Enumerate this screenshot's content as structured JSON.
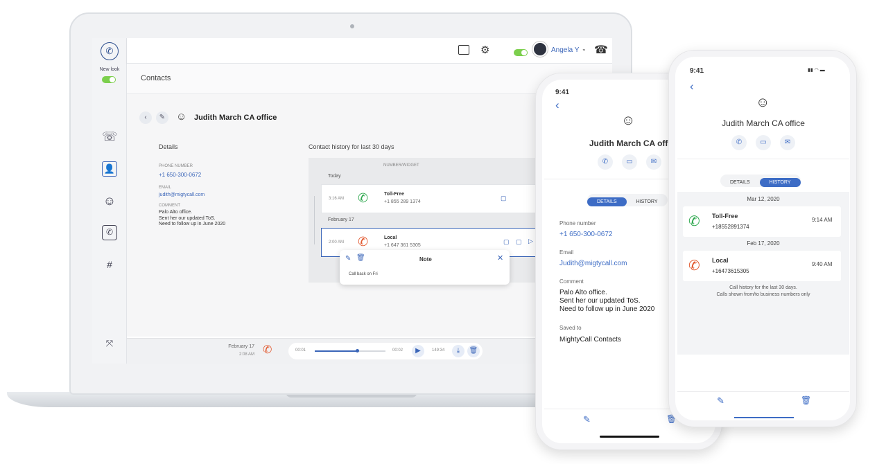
{
  "laptop": {
    "rail": {
      "new_look_label": "New look"
    },
    "topbar": {
      "user_name": "Angela Y"
    },
    "page_title": "Contacts",
    "contact": {
      "name": "Judith March CA office",
      "details_heading": "Details",
      "phone_label": "PHONE NUMBER",
      "phone_value": "+1 650-300-0672",
      "email_label": "EMAIL",
      "email_value": "judith@migtycall.com",
      "comment_label": "COMMENT",
      "comment_lines": [
        "Palo Alto office.",
        "Sent her our updated ToS.",
        "Need to follow up in June 2020"
      ]
    },
    "history": {
      "heading": "Contact history for last 30 days",
      "column_header": "NUMBER/WIDGET",
      "groups": [
        {
          "date": "Today",
          "items": [
            {
              "time": "3:16 AM",
              "type": "Toll-Free",
              "number": "+1 855 289 1374"
            }
          ]
        },
        {
          "date": "February 17",
          "items": [
            {
              "time": "2:00 AM",
              "type": "Local",
              "number": "+1 647 361 5305"
            }
          ]
        }
      ]
    },
    "note": {
      "title": "Note",
      "text": "Call back on Fri"
    },
    "player": {
      "date": "February 17",
      "time": "2:08 AM",
      "elapsed": "00:01",
      "end": "00:02",
      "duration": "149:34",
      "progress": 0.6
    }
  },
  "phone1": {
    "status_time": "9:41",
    "contact_name": "Judith March CA office",
    "tabs": [
      "DETAILS",
      "HISTORY"
    ],
    "active_tab": "DETAILS",
    "phone_label": "Phone number",
    "phone_value": "+1 650-300-0672",
    "email_label": "Email",
    "email_value": "Judith@migtycall.com",
    "comment_label": "Comment",
    "comment_lines": [
      "Palo Alto office.",
      "Sent her our updated ToS.",
      "Need to follow up in June 2020"
    ],
    "saved_label": "Saved to",
    "saved_value": "MightyCall Contacts"
  },
  "phone2": {
    "status_time": "9:41",
    "contact_name": "Judith March CA office",
    "tabs": [
      "DETAILS",
      "HISTORY"
    ],
    "active_tab": "HISTORY",
    "groups": [
      {
        "date": "Mar 12, 2020",
        "type": "Toll-Free",
        "number": "+18552891374",
        "time": "9:14 AM"
      },
      {
        "date": "Feb 17, 2020",
        "type": "Local",
        "number": "+16473615305",
        "time": "9:40 AM"
      }
    ],
    "footer_lines": [
      "Call history for the last 30 days.",
      "Calls shown from/to business numbers only"
    ]
  },
  "colors": {
    "accent": "#3d6cc5",
    "tollfree": "#2fa84f",
    "local": "#e2592f",
    "toggle": "#7ccf4d"
  }
}
